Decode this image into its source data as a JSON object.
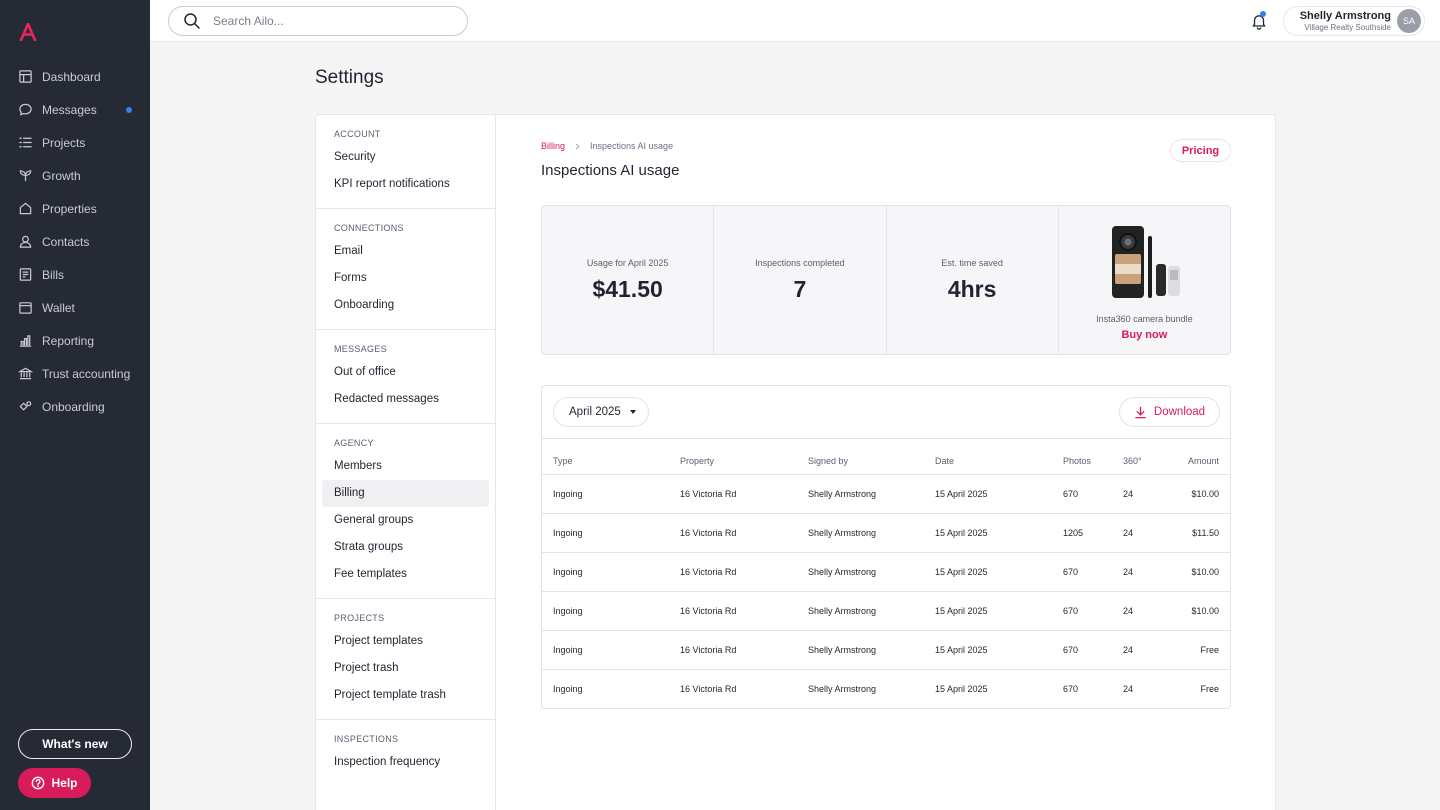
{
  "brand": {
    "accent": "#d81b5a",
    "sidebar_bg": "#252a35",
    "notification_dot": "#3d7bf0"
  },
  "sidebar": {
    "logo_icon": "aliloo-logo-icon",
    "items": [
      {
        "label": "Dashboard",
        "icon": "dashboard-icon"
      },
      {
        "label": "Messages",
        "icon": "chat-bubble-icon",
        "has_unread": true
      },
      {
        "label": "Projects",
        "icon": "checklist-icon"
      },
      {
        "label": "Growth",
        "icon": "sprout-icon"
      },
      {
        "label": "Properties",
        "icon": "house-icon"
      },
      {
        "label": "Contacts",
        "icon": "person-icon"
      },
      {
        "label": "Bills",
        "icon": "receipt-icon"
      },
      {
        "label": "Wallet",
        "icon": "wallet-icon"
      },
      {
        "label": "Reporting",
        "icon": "bar-chart-icon"
      },
      {
        "label": "Trust accounting",
        "icon": "bank-icon"
      },
      {
        "label": "Onboarding",
        "icon": "onboarding-icon"
      }
    ],
    "whats_new_label": "What's new",
    "help_label": "Help"
  },
  "topbar": {
    "search_placeholder": "Search Ailo...",
    "user": {
      "name": "Shelly Armstrong",
      "org": "Village Realty Southside",
      "initials": "SA"
    }
  },
  "page": {
    "title": "Settings"
  },
  "settings_menu": {
    "sections": [
      {
        "heading": "ACCOUNT",
        "items": [
          "Security",
          "KPI report notifications"
        ]
      },
      {
        "heading": "CONNECTIONS",
        "items": [
          "Email",
          "Forms",
          "Onboarding"
        ]
      },
      {
        "heading": "MESSAGES",
        "items": [
          "Out of office",
          "Redacted messages"
        ]
      },
      {
        "heading": "AGENCY",
        "items": [
          "Members",
          "Billing",
          "General groups",
          "Strata groups",
          "Fee templates"
        ]
      },
      {
        "heading": "PROJECTS",
        "items": [
          "Project templates",
          "Project trash",
          "Project template trash"
        ]
      },
      {
        "heading": "INSPECTIONS",
        "items": [
          "Inspection frequency"
        ]
      }
    ],
    "active_item": "Billing"
  },
  "content": {
    "breadcrumb": {
      "parent": "Billing",
      "current": "Inspections AI usage"
    },
    "title": "Inspections AI usage",
    "pricing_label": "Pricing",
    "stats": [
      {
        "label": "Usage for April 2025",
        "value": "$41.50"
      },
      {
        "label": "Inspections completed",
        "value": "7"
      },
      {
        "label": "Est. time saved",
        "value": "4hrs"
      }
    ],
    "promo": {
      "label": "Insta360 camera bundle",
      "cta": "Buy now"
    },
    "month_filter": "April 2025",
    "download_label": "Download",
    "table": {
      "columns": [
        "Type",
        "Property",
        "Signed by",
        "Date",
        "Photos",
        "360°",
        "Amount"
      ],
      "rows": [
        [
          "Ingoing",
          "16 Victoria Rd",
          "Shelly Armstrong",
          "15 April 2025",
          "670",
          "24",
          "$10.00"
        ],
        [
          "Ingoing",
          "16 Victoria Rd",
          "Shelly Armstrong",
          "15 April 2025",
          "1205",
          "24",
          "$11.50"
        ],
        [
          "Ingoing",
          "16 Victoria Rd",
          "Shelly Armstrong",
          "15 April 2025",
          "670",
          "24",
          "$10.00"
        ],
        [
          "Ingoing",
          "16 Victoria Rd",
          "Shelly Armstrong",
          "15 April 2025",
          "670",
          "24",
          "$10.00"
        ],
        [
          "Ingoing",
          "16 Victoria Rd",
          "Shelly Armstrong",
          "15 April 2025",
          "670",
          "24",
          "Free"
        ],
        [
          "Ingoing",
          "16 Victoria Rd",
          "Shelly Armstrong",
          "15 April 2025",
          "670",
          "24",
          "Free"
        ]
      ]
    }
  }
}
